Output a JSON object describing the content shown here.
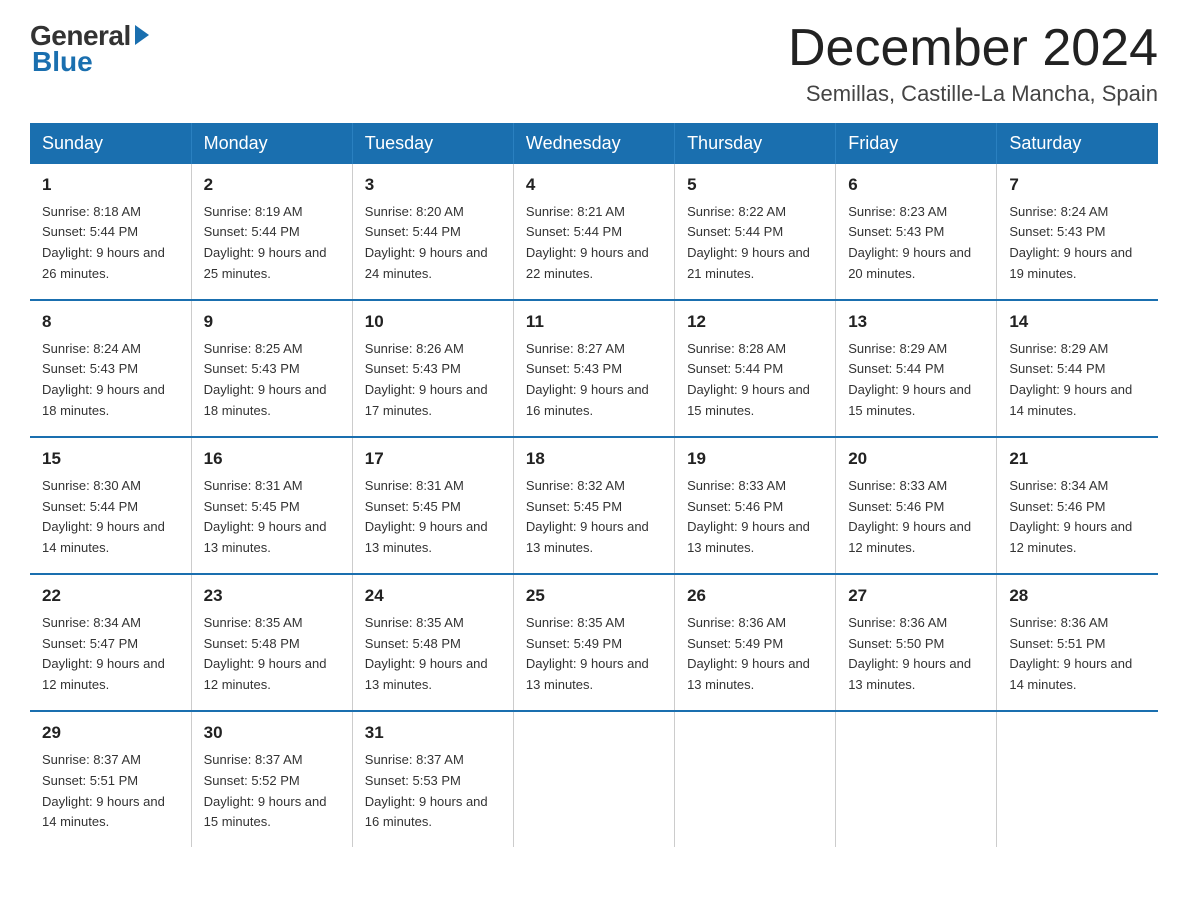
{
  "logo": {
    "general": "General",
    "blue": "Blue"
  },
  "header": {
    "title": "December 2024",
    "location": "Semillas, Castille-La Mancha, Spain"
  },
  "days_of_week": [
    "Sunday",
    "Monday",
    "Tuesday",
    "Wednesday",
    "Thursday",
    "Friday",
    "Saturday"
  ],
  "weeks": [
    [
      {
        "day": "1",
        "sunrise": "8:18 AM",
        "sunset": "5:44 PM",
        "daylight": "9 hours and 26 minutes."
      },
      {
        "day": "2",
        "sunrise": "8:19 AM",
        "sunset": "5:44 PM",
        "daylight": "9 hours and 25 minutes."
      },
      {
        "day": "3",
        "sunrise": "8:20 AM",
        "sunset": "5:44 PM",
        "daylight": "9 hours and 24 minutes."
      },
      {
        "day": "4",
        "sunrise": "8:21 AM",
        "sunset": "5:44 PM",
        "daylight": "9 hours and 22 minutes."
      },
      {
        "day": "5",
        "sunrise": "8:22 AM",
        "sunset": "5:44 PM",
        "daylight": "9 hours and 21 minutes."
      },
      {
        "day": "6",
        "sunrise": "8:23 AM",
        "sunset": "5:43 PM",
        "daylight": "9 hours and 20 minutes."
      },
      {
        "day": "7",
        "sunrise": "8:24 AM",
        "sunset": "5:43 PM",
        "daylight": "9 hours and 19 minutes."
      }
    ],
    [
      {
        "day": "8",
        "sunrise": "8:24 AM",
        "sunset": "5:43 PM",
        "daylight": "9 hours and 18 minutes."
      },
      {
        "day": "9",
        "sunrise": "8:25 AM",
        "sunset": "5:43 PM",
        "daylight": "9 hours and 18 minutes."
      },
      {
        "day": "10",
        "sunrise": "8:26 AM",
        "sunset": "5:43 PM",
        "daylight": "9 hours and 17 minutes."
      },
      {
        "day": "11",
        "sunrise": "8:27 AM",
        "sunset": "5:43 PM",
        "daylight": "9 hours and 16 minutes."
      },
      {
        "day": "12",
        "sunrise": "8:28 AM",
        "sunset": "5:44 PM",
        "daylight": "9 hours and 15 minutes."
      },
      {
        "day": "13",
        "sunrise": "8:29 AM",
        "sunset": "5:44 PM",
        "daylight": "9 hours and 15 minutes."
      },
      {
        "day": "14",
        "sunrise": "8:29 AM",
        "sunset": "5:44 PM",
        "daylight": "9 hours and 14 minutes."
      }
    ],
    [
      {
        "day": "15",
        "sunrise": "8:30 AM",
        "sunset": "5:44 PM",
        "daylight": "9 hours and 14 minutes."
      },
      {
        "day": "16",
        "sunrise": "8:31 AM",
        "sunset": "5:45 PM",
        "daylight": "9 hours and 13 minutes."
      },
      {
        "day": "17",
        "sunrise": "8:31 AM",
        "sunset": "5:45 PM",
        "daylight": "9 hours and 13 minutes."
      },
      {
        "day": "18",
        "sunrise": "8:32 AM",
        "sunset": "5:45 PM",
        "daylight": "9 hours and 13 minutes."
      },
      {
        "day": "19",
        "sunrise": "8:33 AM",
        "sunset": "5:46 PM",
        "daylight": "9 hours and 13 minutes."
      },
      {
        "day": "20",
        "sunrise": "8:33 AM",
        "sunset": "5:46 PM",
        "daylight": "9 hours and 12 minutes."
      },
      {
        "day": "21",
        "sunrise": "8:34 AM",
        "sunset": "5:46 PM",
        "daylight": "9 hours and 12 minutes."
      }
    ],
    [
      {
        "day": "22",
        "sunrise": "8:34 AM",
        "sunset": "5:47 PM",
        "daylight": "9 hours and 12 minutes."
      },
      {
        "day": "23",
        "sunrise": "8:35 AM",
        "sunset": "5:48 PM",
        "daylight": "9 hours and 12 minutes."
      },
      {
        "day": "24",
        "sunrise": "8:35 AM",
        "sunset": "5:48 PM",
        "daylight": "9 hours and 13 minutes."
      },
      {
        "day": "25",
        "sunrise": "8:35 AM",
        "sunset": "5:49 PM",
        "daylight": "9 hours and 13 minutes."
      },
      {
        "day": "26",
        "sunrise": "8:36 AM",
        "sunset": "5:49 PM",
        "daylight": "9 hours and 13 minutes."
      },
      {
        "day": "27",
        "sunrise": "8:36 AM",
        "sunset": "5:50 PM",
        "daylight": "9 hours and 13 minutes."
      },
      {
        "day": "28",
        "sunrise": "8:36 AM",
        "sunset": "5:51 PM",
        "daylight": "9 hours and 14 minutes."
      }
    ],
    [
      {
        "day": "29",
        "sunrise": "8:37 AM",
        "sunset": "5:51 PM",
        "daylight": "9 hours and 14 minutes."
      },
      {
        "day": "30",
        "sunrise": "8:37 AM",
        "sunset": "5:52 PM",
        "daylight": "9 hours and 15 minutes."
      },
      {
        "day": "31",
        "sunrise": "8:37 AM",
        "sunset": "5:53 PM",
        "daylight": "9 hours and 16 minutes."
      },
      null,
      null,
      null,
      null
    ]
  ]
}
